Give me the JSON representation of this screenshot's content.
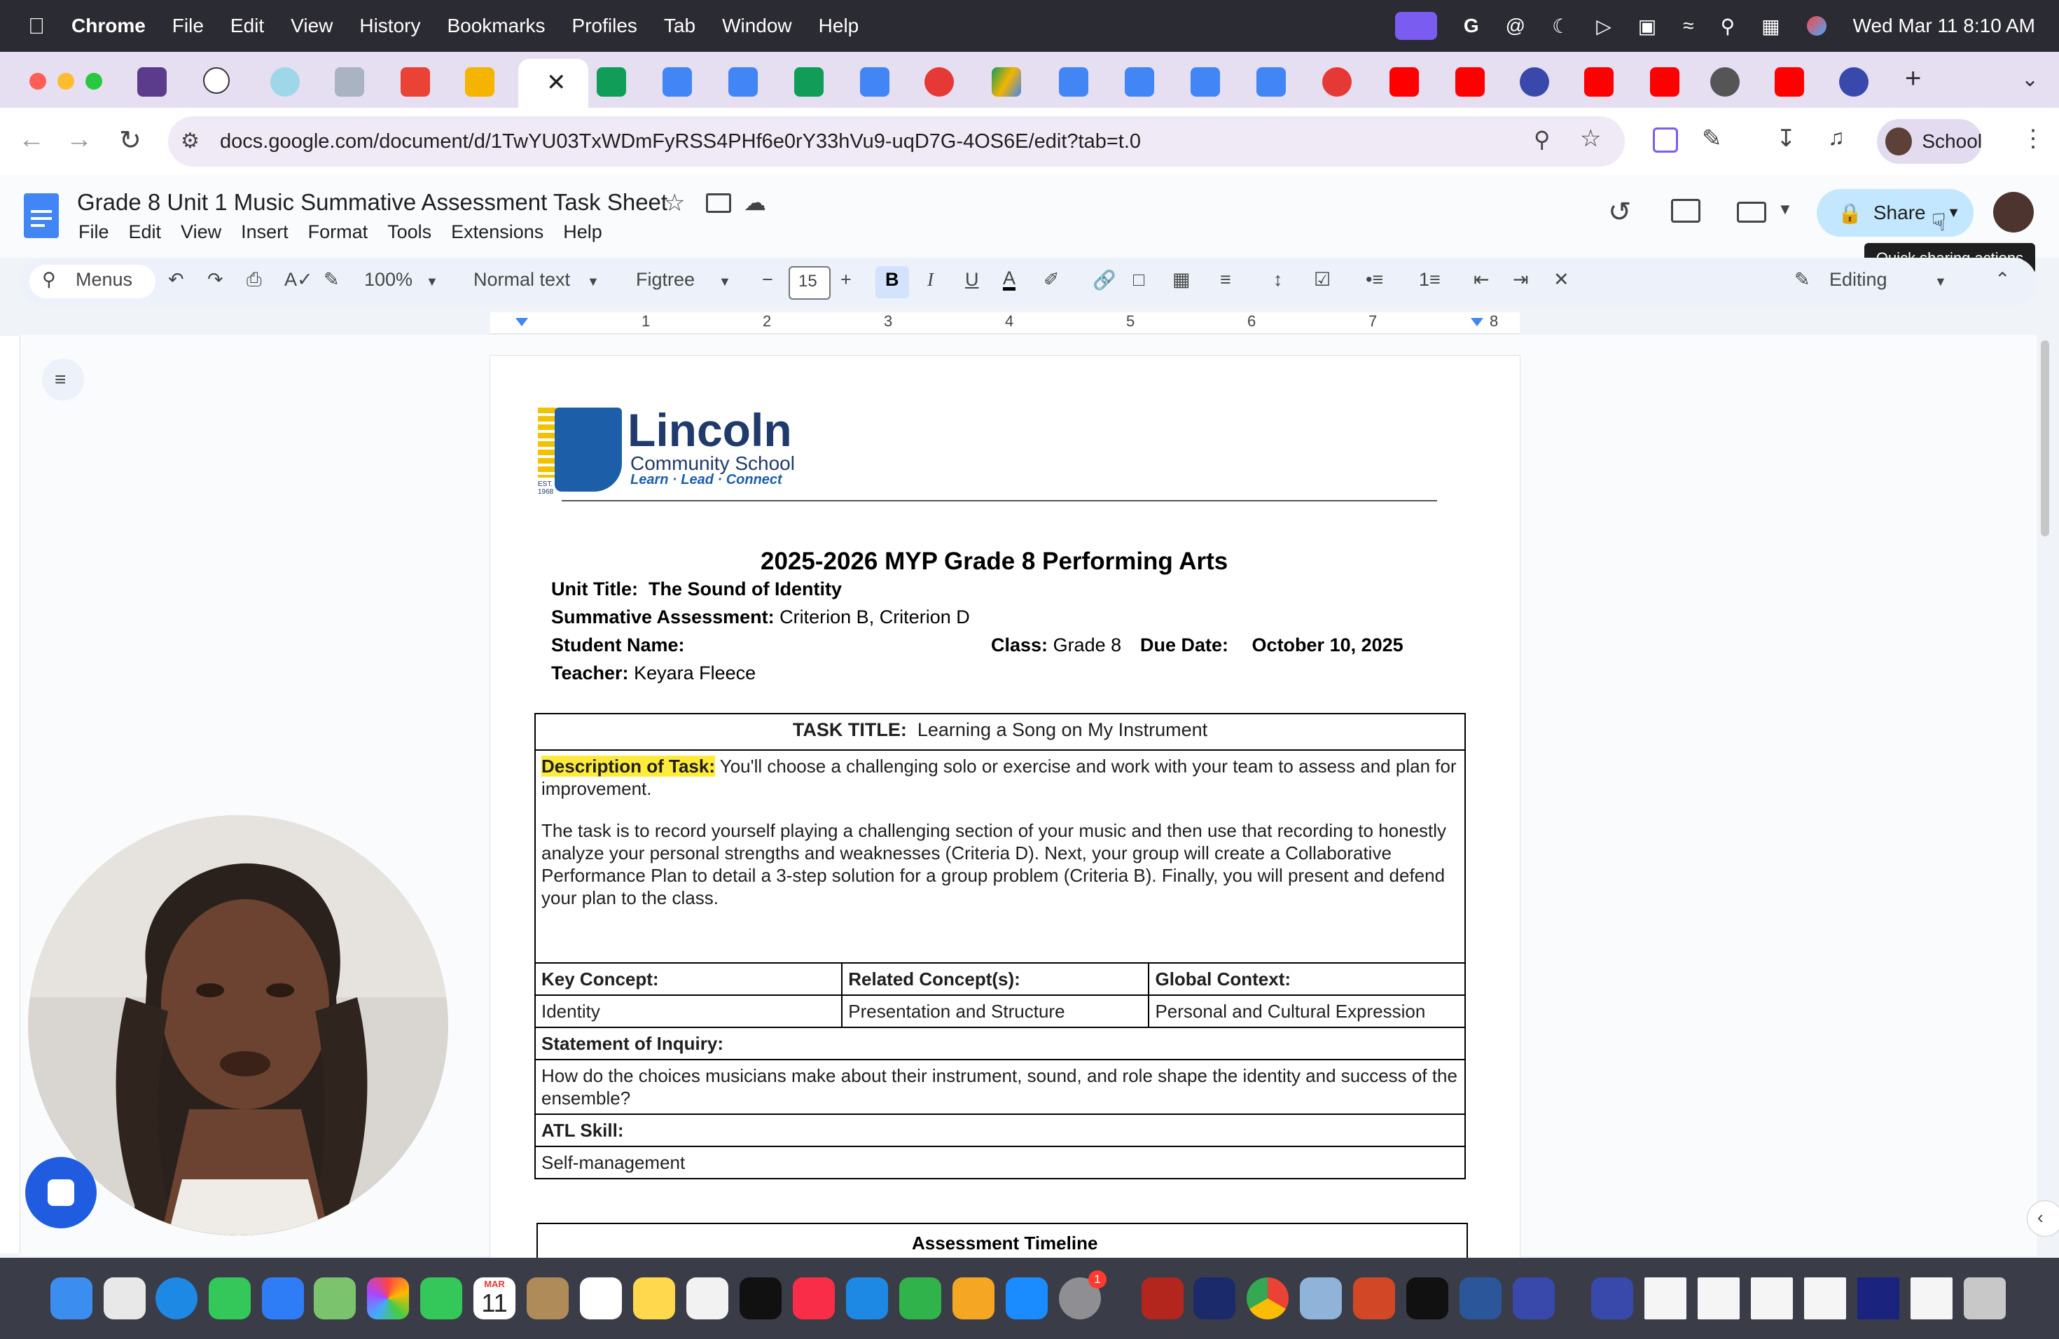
{
  "menubar": {
    "app": "Chrome",
    "items": [
      "File",
      "Edit",
      "View",
      "History",
      "Bookmarks",
      "Profiles",
      "Tab",
      "Window",
      "Help"
    ],
    "clock": "Wed Mar 11  8:10 AM"
  },
  "browser": {
    "url": "docs.google.com/document/d/1TwYU03TxWDmFyRSS4PHf6e0rY33hVu9-uqD7G-4OS6E/edit?tab=t.0",
    "profile_label": "School",
    "new_tab": "+"
  },
  "docs": {
    "title": "Grade 8 Unit 1 Music Summative Assessment Task Sheet",
    "menu": [
      "File",
      "Edit",
      "View",
      "Insert",
      "Format",
      "Tools",
      "Extensions",
      "Help"
    ],
    "share_label": "Share",
    "tooltip": "Quick sharing actions",
    "toolbar": {
      "menus_label": "Menus",
      "zoom": "100%",
      "style": "Normal text",
      "font": "Figtree",
      "font_size": "15",
      "mode": "Editing"
    },
    "ruler_numbers": [
      "1",
      "2",
      "3",
      "4",
      "5",
      "6",
      "7",
      "8"
    ]
  },
  "document": {
    "logo": {
      "name": "Lincoln",
      "sub": "Community School",
      "tagline": "Learn · Lead · Connect",
      "est": "EST. 1968"
    },
    "heading": "2025-2026 MYP Grade 8 Performing Arts",
    "unit_title_label": "Unit Title:",
    "unit_title_value": "The Sound of Identity",
    "summative_label": "Summative Assessment:",
    "summative_value": "Criterion B, Criterion D",
    "student_label": "Student Name:",
    "class_label": "Class:",
    "class_value": "Grade 8",
    "due_label": "Due Date:",
    "due_value": "October 10, 2025",
    "teacher_label": "Teacher:",
    "teacher_value": "Keyara Fleece",
    "table": {
      "task_title_label": "TASK TITLE:",
      "task_title_value": "Learning a Song on My Instrument",
      "desc_label": "Description of Task:",
      "desc_p1": " You'll choose a challenging solo or exercise and work with your team to assess and plan for improvement.",
      "desc_p2": "The task is to record yourself playing a challenging section of your music and then use that recording to honestly analyze your personal strengths and weaknesses (Criteria D). Next, your group will create a Collaborative Performance Plan to detail a 3-step solution for a group problem (Criteria B). Finally, you will present and defend your plan to the class.",
      "key_concept_label": "Key Concept:",
      "related_label": "Related Concept(s):",
      "global_label": "Global Context:",
      "key_concept": "Identity",
      "related": "Presentation and Structure",
      "global": "Personal and Cultural Expression",
      "soi_label": "Statement of Inquiry:",
      "soi": "How do the choices musicians make about their instrument, sound, and role shape the identity and success of the ensemble?",
      "atl_label": "ATL Skill:",
      "atl": "Self-management"
    },
    "timeline_heading": "Assessment Timeline"
  },
  "dock": {
    "calendar_month": "MAR",
    "calendar_day": "11",
    "badge": "1"
  },
  "colors": {
    "docs_blue": "#4285f4",
    "share_bg": "#c2e7ff",
    "highlight": "#ffeb3b",
    "lincoln_blue": "#1c5fa8"
  }
}
